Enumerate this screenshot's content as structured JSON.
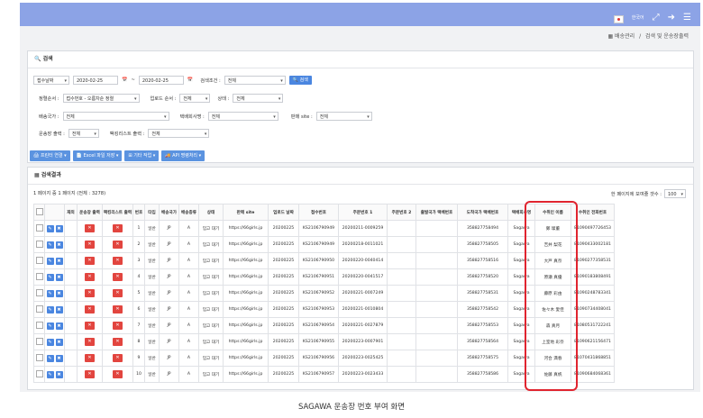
{
  "topbar": {
    "lang": "한국어",
    "icons": [
      "flag-icon",
      "expand-icon",
      "logout-icon",
      "menu-icon"
    ]
  },
  "breadcrumb": {
    "home": "배송관리",
    "sep": "/",
    "current": "검색 및 운송장출력"
  },
  "search": {
    "title": "검색",
    "date_type": "접수날짜",
    "date_from": "2020-02-25",
    "date_to": "2020-02-25",
    "cond_label": "검색조건 :",
    "cond_value": "전체",
    "search_btn": "검색",
    "sort_label": "정렬순서 :",
    "sort_value": "접수번호 - 오름차순 정렬",
    "upload_label": "업로드 순서 :",
    "upload_value": "전체",
    "status_label": "상태 :",
    "status_value": "전체",
    "dest_label": "배송국가 :",
    "dest_value": "전체",
    "carrier_label": "택배회사명 :",
    "carrier_value": "전체",
    "site_label": "판매 site :",
    "site_value": "전체",
    "waybill_label": "운송장 출력 :",
    "waybill_value": "전체",
    "pack_label": "팩킹리스트 출력 :",
    "pack_value": "전체"
  },
  "actions": [
    "프린터 연결",
    "Excel 파일 저장",
    "기타 작업",
    "API 명령처리"
  ],
  "results": {
    "title": "검색결과",
    "count_line": "1 페이지 중 1 페이지 (전체 : 3278)",
    "perpage_label": "한 페이지에 보여줄 갯수 :",
    "perpage_value": "100",
    "columns": [
      "",
      "",
      "재외",
      "운송장 출력",
      "팩킹리스트 출력",
      "번호",
      "타입",
      "배송국가",
      "배송종류",
      "상태",
      "판매 site",
      "업로드 날짜",
      "접수번호",
      "주문번호 1",
      "주문번호 2",
      "출발국가 택배번호",
      "도착국가 택배번호",
      "택배회사명",
      "수취인 이름",
      "수취인 전화번호"
    ],
    "rows": [
      {
        "no": "1",
        "type": "일반",
        "country": "JP",
        "kind": "A",
        "status": "입고 대기",
        "site": "https://66girls.jp",
        "date": "20200225",
        "reg": "KS2106790949",
        "order1": "20200211-0009259",
        "dest_no": "358827758494",
        "carrier": "Sagawa",
        "name": "鄭 璨董",
        "phone": "81090497726453"
      },
      {
        "no": "2",
        "type": "일반",
        "country": "JP",
        "kind": "A",
        "status": "입고 대기",
        "site": "https://66girls.jp",
        "date": "20200225",
        "reg": "KS2106790949",
        "order1": "20200218-0011021",
        "dest_no": "358827758505",
        "carrier": "Sagawa",
        "name": "吉井 梨花",
        "phone": "81090433002181"
      },
      {
        "no": "3",
        "type": "일반",
        "country": "JP",
        "kind": "A",
        "status": "입고 대기",
        "site": "https://66girls.jp",
        "date": "20200225",
        "reg": "KS2106790950",
        "order1": "20200220-0040414",
        "dest_no": "358827758516",
        "carrier": "Sagawa",
        "name": "大戸 真奈",
        "phone": "81090277358531"
      },
      {
        "no": "4",
        "type": "일반",
        "country": "JP",
        "kind": "A",
        "status": "입고 대기",
        "site": "https://66girls.jp",
        "date": "20200225",
        "reg": "KS2106790951",
        "order1": "20200220-0041517",
        "dest_no": "358827758520",
        "carrier": "Sagawa",
        "name": "原瀬 真優",
        "phone": "81090183808491"
      },
      {
        "no": "5",
        "type": "일반",
        "country": "JP",
        "kind": "A",
        "status": "입고 대기",
        "site": "https://66girls.jp",
        "date": "20200225",
        "reg": "KS2106790952",
        "order1": "20200221-0007249",
        "dest_no": "358827758531",
        "carrier": "Sagawa",
        "name": "藤原 彩由",
        "phone": "81090248783341"
      },
      {
        "no": "6",
        "type": "일반",
        "country": "JP",
        "kind": "A",
        "status": "입고 대기",
        "site": "https://66girls.jp",
        "date": "20200225",
        "reg": "KS2106790953",
        "order1": "20200221-0010804",
        "dest_no": "358827758542",
        "carrier": "Sagawa",
        "name": "佐々木 愛佳",
        "phone": "81090734408041"
      },
      {
        "no": "7",
        "type": "일반",
        "country": "JP",
        "kind": "A",
        "status": "입고 대기",
        "site": "https://66girls.jp",
        "date": "20200225",
        "reg": "KS2106790954",
        "order1": "20200221-0027879",
        "dest_no": "358827758553",
        "carrier": "Sagawa",
        "name": "森 真月",
        "phone": "81080531722241"
      },
      {
        "no": "8",
        "type": "일반",
        "country": "JP",
        "kind": "A",
        "status": "입고 대기",
        "site": "https://66girls.jp",
        "date": "20200225",
        "reg": "KS2106790955",
        "order1": "20200223-0007901",
        "dest_no": "358827758564",
        "carrier": "Sagawa",
        "name": "上室地 彩奈",
        "phone": "81090621156471"
      },
      {
        "no": "9",
        "type": "일반",
        "country": "JP",
        "kind": "A",
        "status": "입고 대기",
        "site": "https://66girls.jp",
        "date": "20200225",
        "reg": "KS2106790956",
        "order1": "20200223-0025425",
        "dest_no": "358827758575",
        "carrier": "Sagawa",
        "name": "河合 満春",
        "phone": "81070431868851"
      },
      {
        "no": "10",
        "type": "일반",
        "country": "JP",
        "kind": "A",
        "status": "입고 대기",
        "site": "https://66girls.jp",
        "date": "20200225",
        "reg": "KS2106790957",
        "order1": "20200223-0023433",
        "dest_no": "358827758586",
        "carrier": "Sagawa",
        "name": "佐藤 真帆",
        "phone": "81090684068361"
      }
    ]
  },
  "caption": "SAGAWA 운송장 번호 부여 화면",
  "colors": {
    "topbar": "#8ca3e6",
    "button": "#4a86e0",
    "delete": "#e2453f",
    "highlight": "#e0242f"
  }
}
